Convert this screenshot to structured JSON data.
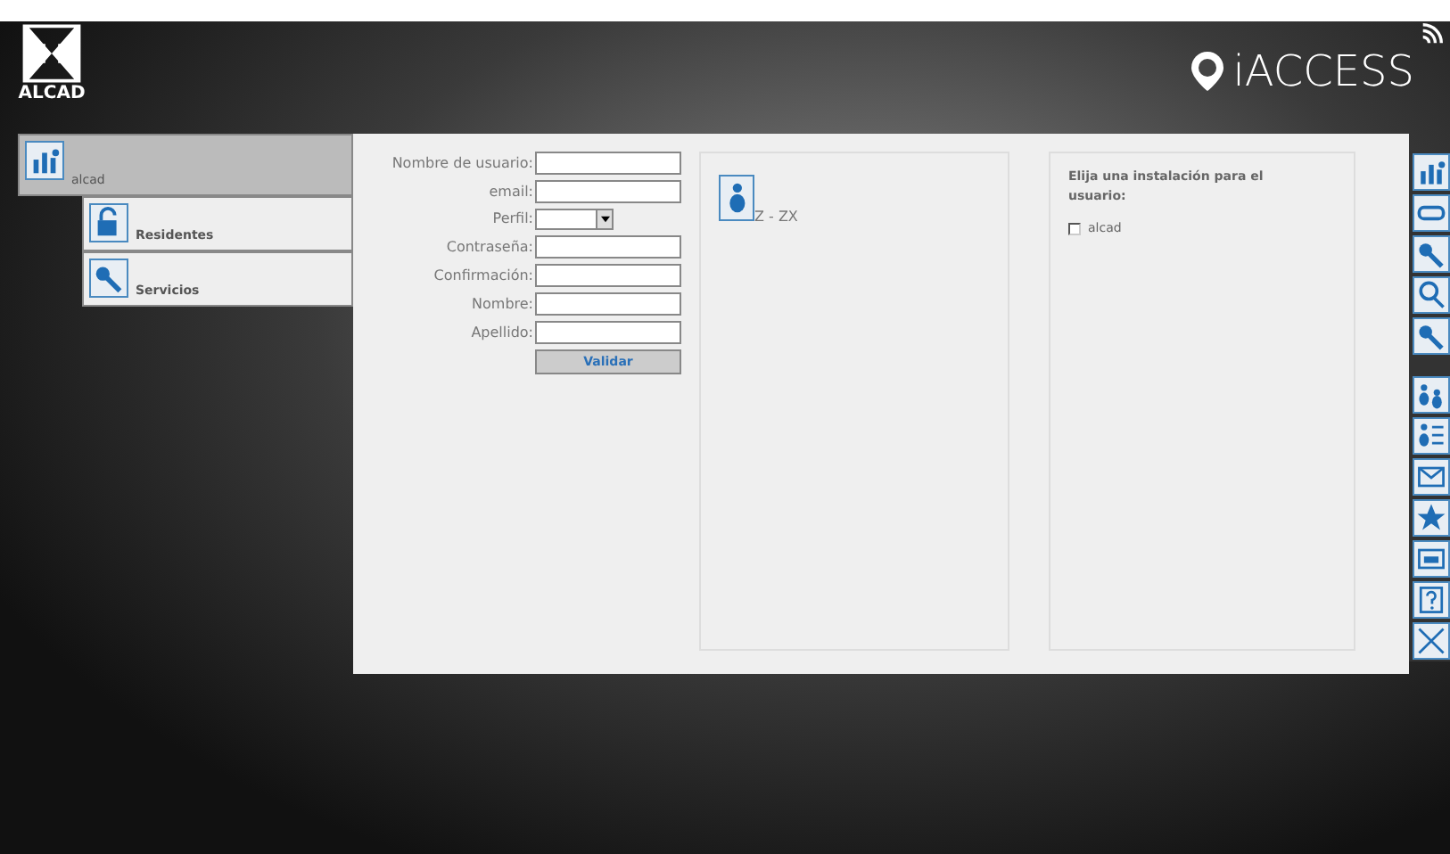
{
  "header": {
    "brand": "ALCAD",
    "product": "iACCESS"
  },
  "menu": [
    {
      "label": "alcad",
      "selected": true,
      "children": [
        {
          "label": "Residentes",
          "selected": false
        },
        {
          "label": "Servicios",
          "selected": false
        }
      ]
    }
  ],
  "form": {
    "fields": [
      {
        "label": "Nombre de usuario:",
        "kind": "text"
      },
      {
        "label": "email:",
        "kind": "text"
      },
      {
        "label": "Perfil:",
        "kind": "select"
      },
      {
        "label": "Contraseña:",
        "kind": "text"
      },
      {
        "label": "Confirmación:",
        "kind": "text"
      },
      {
        "label": "Nombre:",
        "kind": "text"
      },
      {
        "label": "Apellido:",
        "kind": "text"
      }
    ],
    "submit": "Validar"
  },
  "user_panel": {
    "range": "Z - ZX"
  },
  "install_panel": {
    "title": "Elija una instalación para el usuario:",
    "options": [
      {
        "label": "alcad",
        "checked": false
      }
    ]
  }
}
